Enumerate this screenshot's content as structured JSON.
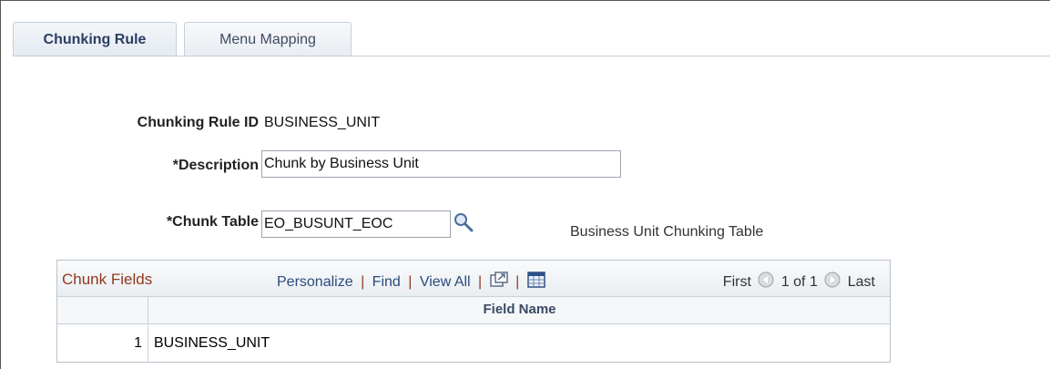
{
  "tabs": [
    {
      "label": "Chunking Rule",
      "active": true
    },
    {
      "label": "Menu Mapping",
      "active": false
    }
  ],
  "form": {
    "rule_id_label": "Chunking Rule ID",
    "rule_id_value": "BUSINESS_UNIT",
    "description_label": "*Description",
    "description_value": "Chunk by Business Unit",
    "chunk_table_label": "*Chunk Table",
    "chunk_table_value": "EO_BUSUNT_EOC",
    "chunk_table_desc": "Business Unit Chunking Table"
  },
  "grid": {
    "title": "Chunk Fields",
    "personalize": "Personalize",
    "find": "Find",
    "view_all": "View All",
    "sep": "|",
    "first": "First",
    "range": "1 of 1",
    "last": "Last",
    "column_header": "Field Name",
    "rows": [
      {
        "num": "1",
        "field_name": "BUSINESS_UNIT"
      }
    ]
  },
  "icons": {
    "lookup": "magnifier-icon",
    "zoom": "new-window-icon",
    "download": "spreadsheet-icon",
    "prev": "arrow-left-icon",
    "next": "arrow-right-icon"
  },
  "colors": {
    "link": "#2b4a7d",
    "grid_title": "#8e3a1e",
    "tab_border": "#c3cfdc"
  }
}
